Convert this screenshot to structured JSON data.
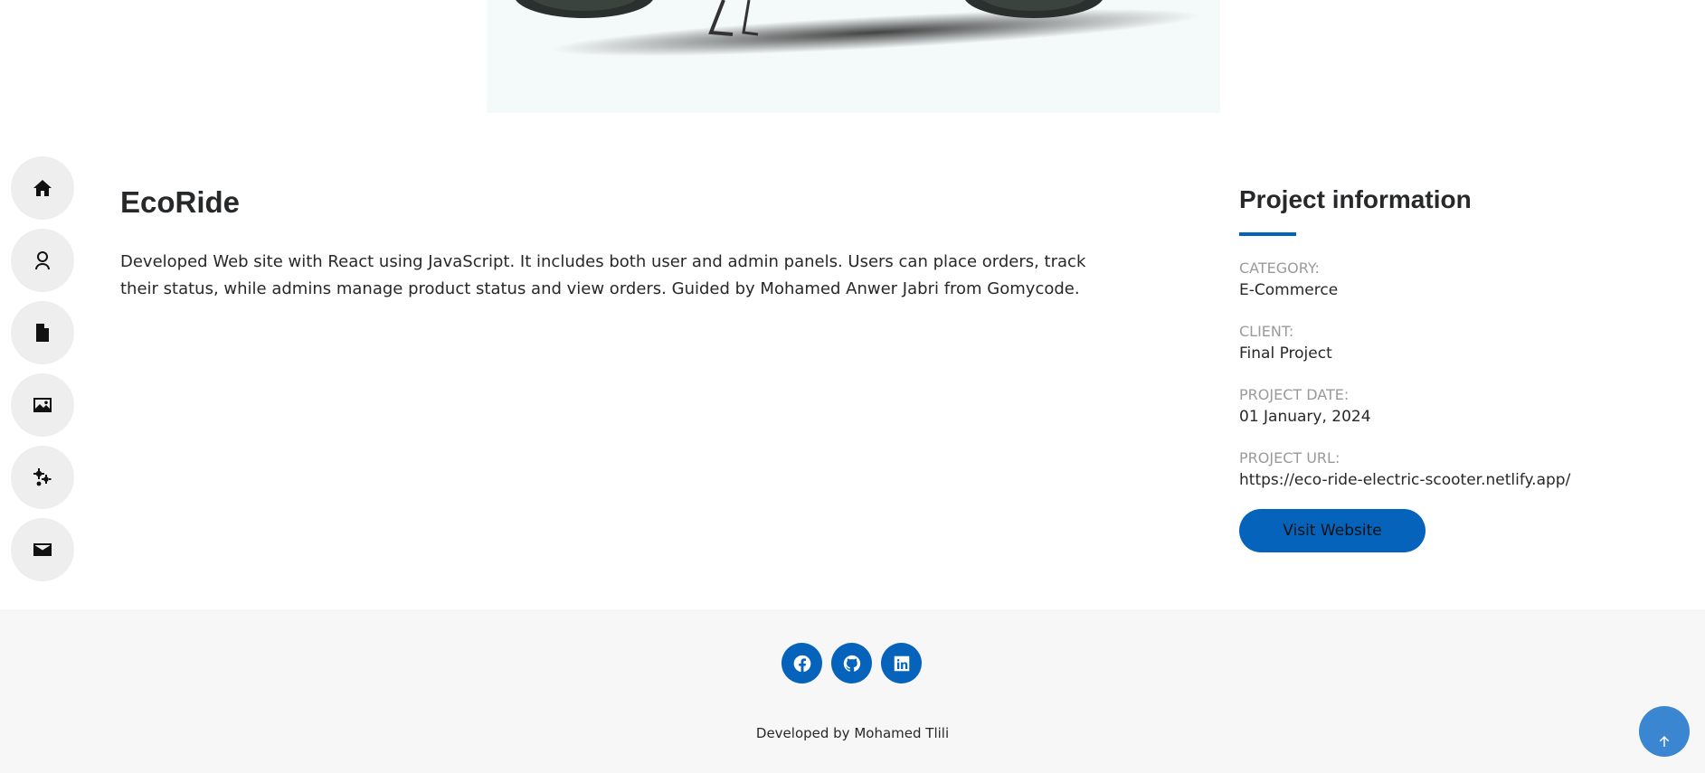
{
  "hero": {
    "image_alt": "electric scooter"
  },
  "sidenav": {
    "items": [
      {
        "icon": "home-icon"
      },
      {
        "icon": "user-icon"
      },
      {
        "icon": "file-icon"
      },
      {
        "icon": "image-icon"
      },
      {
        "icon": "gears-icon"
      },
      {
        "icon": "envelope-icon"
      }
    ]
  },
  "project": {
    "title": "EcoRide",
    "description": "Developed Web site with React using JavaScript. It includes both user and admin panels. Users can place orders, track their status, while admins manage product status and view orders. Guided by Mohamed Anwer Jabri from Gomycode."
  },
  "info": {
    "title": "Project information",
    "fields": [
      {
        "label": "CATEGORY:",
        "value": "E-Commerce"
      },
      {
        "label": "CLIENT:",
        "value": "Final Project"
      },
      {
        "label": "PROJECT DATE:",
        "value": "01 January, 2024"
      },
      {
        "label": "PROJECT URL:",
        "value": "https://eco-ride-electric-scooter.netlify.app/"
      }
    ],
    "visit_label": "Visit Website"
  },
  "footer": {
    "socials": [
      "facebook-icon",
      "github-icon",
      "linkedin-icon"
    ],
    "credits_prefix": "Developed by ",
    "credits_author": "Mohamed Tlili"
  },
  "colors": {
    "accent": "#0563bb",
    "footer_bg": "#f7f7f7",
    "nav_bg": "#eeeeee"
  }
}
